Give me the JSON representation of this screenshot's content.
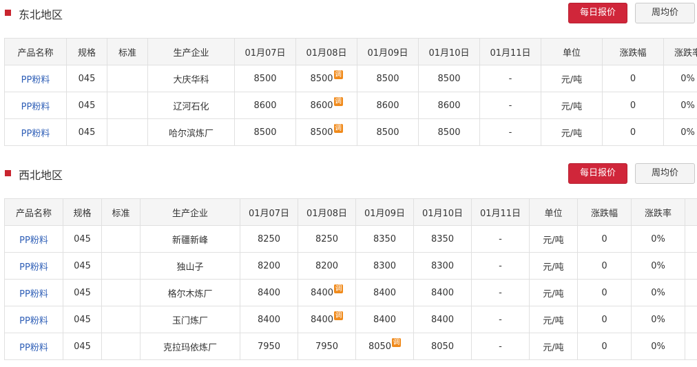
{
  "sections": [
    {
      "title": "东北地区",
      "daily_label": "每日报价",
      "weekly_label": "周均价",
      "headers": [
        "产品名称",
        "规格",
        "标准",
        "生产企业",
        "01月07日",
        "01月08日",
        "01月09日",
        "01月10日",
        "01月11日",
        "单位",
        "涨跌幅",
        "涨跌率"
      ],
      "rows": [
        {
          "product": "PP粉料",
          "spec": "045",
          "standard": "",
          "company": "大庆华科",
          "d1": "8500",
          "d2": "8500",
          "d3": "8500",
          "d4": "8500",
          "d5": "-",
          "unit": "元/吨",
          "change": "0",
          "rate": "0%",
          "adj": "d2"
        },
        {
          "product": "PP粉料",
          "spec": "045",
          "standard": "",
          "company": "辽河石化",
          "d1": "8600",
          "d2": "8600",
          "d3": "8600",
          "d4": "8600",
          "d5": "-",
          "unit": "元/吨",
          "change": "0",
          "rate": "0%",
          "adj": "d2"
        },
        {
          "product": "PP粉料",
          "spec": "045",
          "standard": "",
          "company": "哈尔滨炼厂",
          "d1": "8500",
          "d2": "8500",
          "d3": "8500",
          "d4": "8500",
          "d5": "-",
          "unit": "元/吨",
          "change": "0",
          "rate": "0%",
          "adj": "d2"
        }
      ]
    },
    {
      "title": "西北地区",
      "daily_label": "每日报价",
      "weekly_label": "周均价",
      "headers": [
        "产品名称",
        "规格",
        "标准",
        "生产企业",
        "01月07日",
        "01月08日",
        "01月09日",
        "01月10日",
        "01月11日",
        "单位",
        "涨跌幅",
        "涨跌率"
      ],
      "rows": [
        {
          "product": "PP粉料",
          "spec": "045",
          "standard": "",
          "company": "新疆新峰",
          "d1": "8250",
          "d2": "8250",
          "d3": "8350",
          "d4": "8350",
          "d5": "-",
          "unit": "元/吨",
          "change": "0",
          "rate": "0%",
          "adj": ""
        },
        {
          "product": "PP粉料",
          "spec": "045",
          "standard": "",
          "company": "独山子",
          "d1": "8200",
          "d2": "8200",
          "d3": "8300",
          "d4": "8300",
          "d5": "-",
          "unit": "元/吨",
          "change": "0",
          "rate": "0%",
          "adj": ""
        },
        {
          "product": "PP粉料",
          "spec": "045",
          "standard": "",
          "company": "格尔木炼厂",
          "d1": "8400",
          "d2": "8400",
          "d3": "8400",
          "d4": "8400",
          "d5": "-",
          "unit": "元/吨",
          "change": "0",
          "rate": "0%",
          "adj": "d2"
        },
        {
          "product": "PP粉料",
          "spec": "045",
          "standard": "",
          "company": "玉门炼厂",
          "d1": "8400",
          "d2": "8400",
          "d3": "8400",
          "d4": "8400",
          "d5": "-",
          "unit": "元/吨",
          "change": "0",
          "rate": "0%",
          "adj": "d2"
        },
        {
          "product": "PP粉料",
          "spec": "045",
          "standard": "",
          "company": "克拉玛依炼厂",
          "d1": "7950",
          "d2": "7950",
          "d3": "8050",
          "d4": "8050",
          "d5": "-",
          "unit": "元/吨",
          "change": "0",
          "rate": "0%",
          "adj": "d3"
        }
      ]
    }
  ],
  "adjust_badge": "调"
}
